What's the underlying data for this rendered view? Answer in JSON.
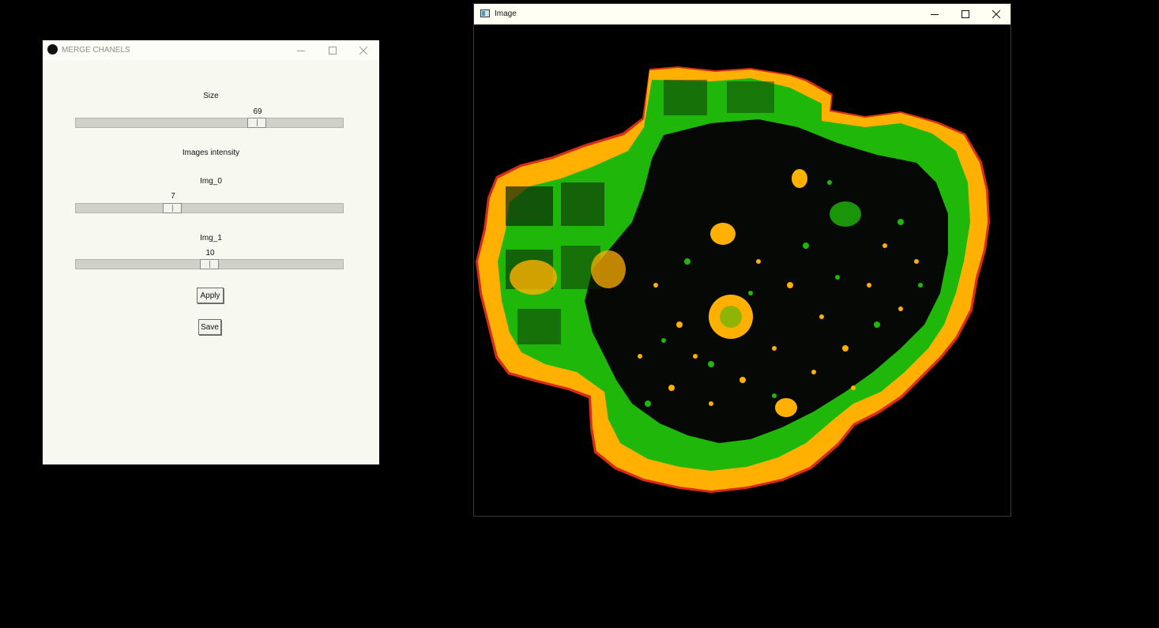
{
  "merge_window": {
    "title": "MERGE CHANELS",
    "size_label": "Size",
    "size_value": "69",
    "size_fraction": 0.69,
    "intensity_heading": "Images intensity",
    "img0_label": "Img_0",
    "img0_value": "7",
    "img0_fraction": 0.35,
    "img1_label": "Img_1",
    "img1_value": "10",
    "img1_fraction": 0.5,
    "apply_label": "Apply",
    "save_label": "Save"
  },
  "image_window": {
    "title": "Image",
    "content_description_colors": {
      "background": "#000000",
      "orange": "#ffb000",
      "green": "#1fb80a",
      "red": "#d92b1a"
    }
  },
  "icons": {
    "minimize": "minimize-icon",
    "maximize": "maximize-icon",
    "close": "close-icon",
    "app": "app-icon",
    "image_window": "image-window-icon"
  }
}
